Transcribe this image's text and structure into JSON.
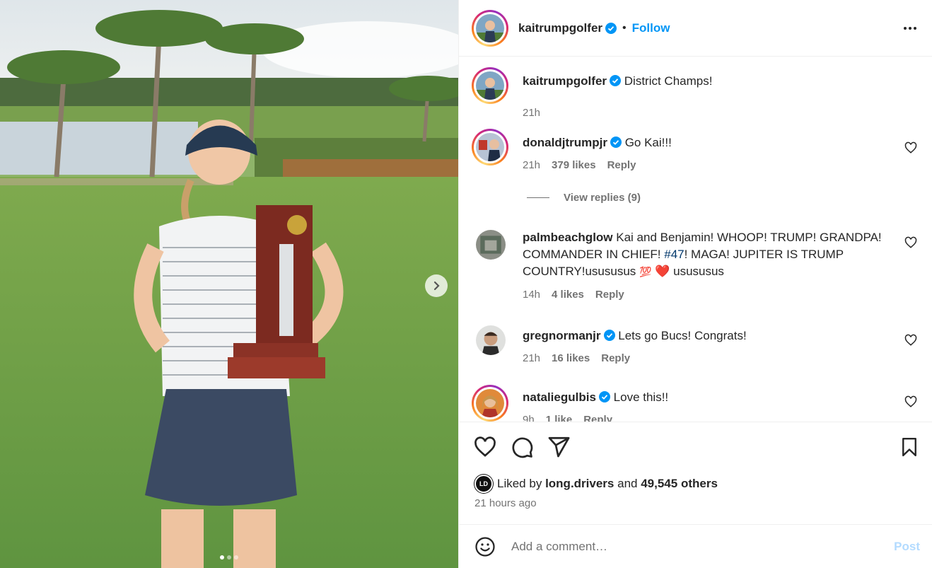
{
  "post": {
    "author": "kaitrumpgolfer",
    "follow_label": "Follow",
    "bullet": "•",
    "more_icon": "more-horizontal-icon",
    "caption": "District Champs!",
    "caption_time": "21h",
    "carousel": {
      "slides": 3,
      "active": 1
    }
  },
  "comments": [
    {
      "user": "donaldjtrumpjr",
      "verified": true,
      "text": "Go Kai!!!",
      "time": "21h",
      "likes": "379 likes",
      "reply": "Reply",
      "view_replies": "View replies (9)"
    },
    {
      "user": "palmbeachglow",
      "verified": false,
      "text_before": "Kai and Benjamin! WHOOP! TRUMP! GRANDPA! COMMANDER IN CHIEF! ",
      "hashtag": "#47",
      "text_after": "! MAGA! JUPITER IS TRUMP COUNTRY!usususus",
      "emoji_100": "💯",
      "emoji_heart": "❤️",
      "text_end": "usususus",
      "time": "14h",
      "likes": "4 likes",
      "reply": "Reply"
    },
    {
      "user": "gregnormanjr",
      "verified": true,
      "text": "Lets go Bucs! Congrats!",
      "time": "21h",
      "likes": "16 likes",
      "reply": "Reply"
    },
    {
      "user": "nataliegulbis",
      "verified": true,
      "text": "Love this!!",
      "time": "9h",
      "likes": "1 like",
      "reply": "Reply"
    }
  ],
  "actions": {
    "liked_by_prefix": "Liked by",
    "liked_by_user": "long.drivers",
    "liked_by_and": "and",
    "liked_by_others": "49,545 others",
    "liked_by_avatar_text": "LD",
    "time_ago": "21 hours ago"
  },
  "composer": {
    "placeholder": "Add a comment…",
    "post_label": "Post"
  },
  "colors": {
    "accent": "#0095f6",
    "verified": "#0095f6",
    "muted": "#737373",
    "heart_emoji": "#e0245e"
  }
}
